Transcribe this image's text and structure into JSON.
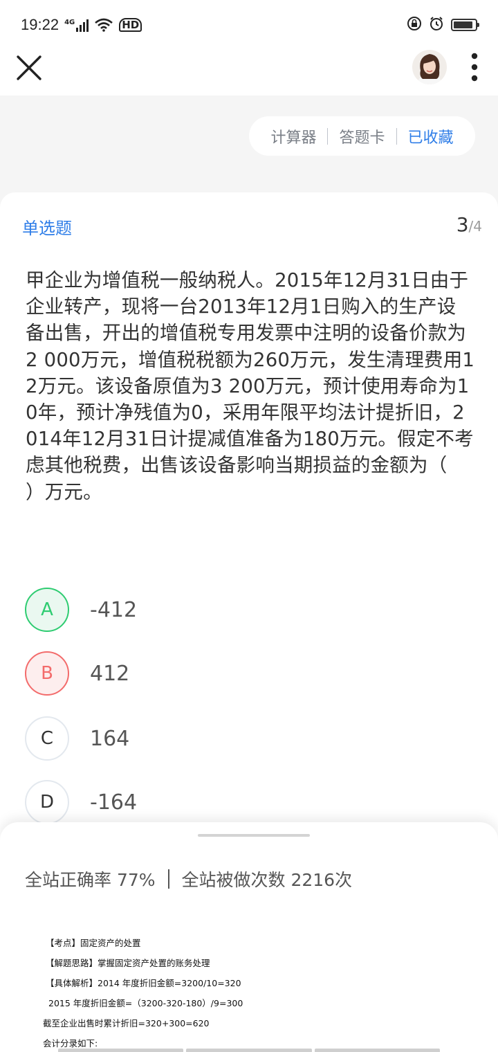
{
  "status_bar": {
    "time": "19:22",
    "network": "4G",
    "hd": "HD"
  },
  "nav": {
    "close_icon": "close-icon",
    "more_icon": "more-vertical-icon"
  },
  "tools": {
    "calculator": "计算器",
    "answer_card": "答题卡",
    "favorited": "已收藏"
  },
  "question": {
    "type": "单选题",
    "current": "3",
    "total": "/4",
    "stem": "甲企业为增值税一般纳税人。2015年12月31日由于企业转产，现将一台2013年12月1日购入的生产设备出售，开出的增值税专用发票中注明的设备价款为2 000万元，增值税税额为260万元，发生清理费用12万元。该设备原值为3 200万元，预计使用寿命为10年，预计净残值为0，采用年限平均法计提折旧，2014年12月31日计提减值准备为180万元。假定不考虑其他税费，出售该设备影响当期损益的金额为（　　）万元。",
    "options": [
      {
        "letter": "A",
        "text": "-412",
        "state": "correct"
      },
      {
        "letter": "B",
        "text": "412",
        "state": "wrong"
      },
      {
        "letter": "C",
        "text": "164",
        "state": "normal"
      },
      {
        "letter": "D",
        "text": "-164",
        "state": "normal"
      }
    ],
    "colors": {
      "correct": "#2ecc71",
      "wrong": "#f36b6b",
      "accent": "#2f7ee8"
    }
  },
  "sheet": {
    "accuracy": "全站正确率 77%",
    "attempts": "全站被做次数 2216次",
    "analysis": {
      "line1": "【考点】固定资产的处置",
      "line2": "【解题思路】掌握固定资产处置的账务处理",
      "line3": "【具体解析】2014 年度折旧金额=3200/10=320",
      "line4": "2015 年度折旧金额=（3200-320-180）/9=300",
      "line5": "截至企业出售时累计折旧=320+300=620",
      "line6": "会计分录如下:"
    }
  }
}
